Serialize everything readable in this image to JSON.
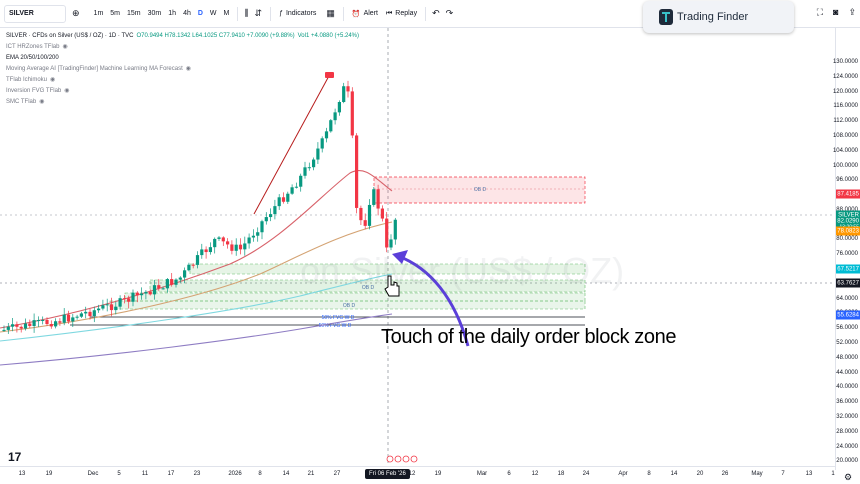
{
  "toolbar": {
    "symbol": "SILVER",
    "timeframes": [
      "1m",
      "5m",
      "15m",
      "30m",
      "1h",
      "4h",
      "D",
      "W",
      "M"
    ],
    "active_timeframe": "D",
    "indicators_label": "Indicators",
    "alert_label": "Alert",
    "replay_label": "Replay"
  },
  "brand": {
    "name": "Trading Finder"
  },
  "legend": {
    "title": "SILVER · CFDs on Silver (US$ / OZ) · 1D · TVC",
    "ohlc": "O70.9494 H78.1342 L64.1025 C77.9410 +7.0090 (+9.88%)",
    "volume": "Vol1 +4.0880 (+5.24%)",
    "indicators": [
      "ICT HRZones TFlab",
      "EMA 20/50/100/200",
      "Moving Average AI [TradingFinder] Machine Learning MA Forecast",
      "TFlab Ichimoku",
      "Inversion FVG TFlab",
      "SMC TFlab"
    ]
  },
  "watermark": "on Silver (US$ / OZ)",
  "annotation": "Touch of the daily order block zone",
  "zones": {
    "ob_upper": "OB D",
    "ob_lower": "OB D",
    "ob_lower2": "OB D",
    "fvg1": "50% FVG W D",
    "fvg2": "50% FVG W D"
  },
  "price_axis": {
    "labels": [
      "130.0000",
      "124.0000",
      "120.0000",
      "116.0000",
      "112.0000",
      "108.0000",
      "104.0000",
      "100.0000",
      "96.0000",
      "92.0000",
      "88.0000",
      "84.0000",
      "80.0000",
      "76.0000",
      "72.0000",
      "68.0000",
      "64.0000",
      "60.0000",
      "56.0000",
      "52.0000",
      "48.0000",
      "44.0000",
      "40.0000",
      "36.0000",
      "32.0000",
      "28.0000",
      "24.0000",
      "20.0000"
    ],
    "tags": [
      {
        "text": "87.4185",
        "color": "#f23645"
      },
      {
        "text": "SILVER",
        "color": "#089981"
      },
      {
        "text": "82.0290",
        "color": "#089981"
      },
      {
        "text": "13:20:55",
        "color": "#089981"
      },
      {
        "text": "78.0823",
        "color": "#ff9800"
      },
      {
        "text": "67.5217",
        "color": "#00bcd4"
      },
      {
        "text": "63.7627",
        "color": "#131722"
      },
      {
        "text": "55.6284",
        "color": "#2962ff"
      }
    ]
  },
  "time_axis": {
    "labels": [
      "13",
      "19",
      "Dec",
      "5",
      "11",
      "17",
      "23",
      "2026",
      "8",
      "14",
      "21",
      "27",
      "Feb",
      "12",
      "19",
      "Mar",
      "6",
      "12",
      "18",
      "24",
      "Apr",
      "8",
      "14",
      "20",
      "26",
      "May",
      "7",
      "13",
      "1"
    ],
    "crosshair_date": "Fri 06 Feb '26"
  },
  "colors": {
    "up": "#089981",
    "down": "#f23645",
    "ob_zone": "#f23645",
    "demand_zone": "#4caf50",
    "arrow": "#5b3fd9"
  }
}
